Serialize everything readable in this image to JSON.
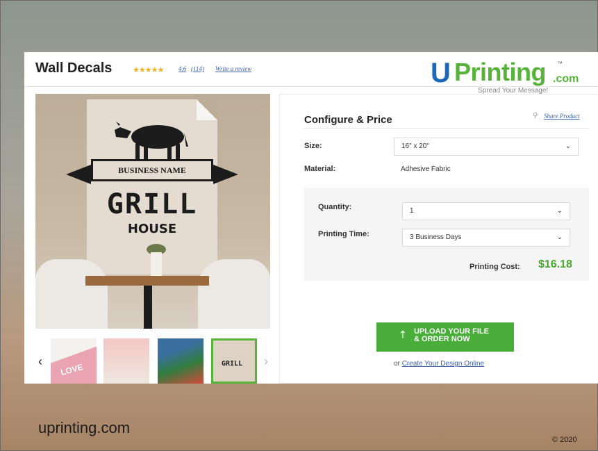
{
  "product": {
    "title": "Wall Decals",
    "stars": "★★★★★",
    "rating": "4.6",
    "reviews": "(114)",
    "write_review": "Write a review"
  },
  "logo": {
    "u": "U",
    "printing": "Printing",
    "com": ".com",
    "tm": "™",
    "tagline": "Spread Your Message!"
  },
  "decal": {
    "banner": "BUSINESS NAME",
    "line1": "GRILL",
    "line2": "HOUSE"
  },
  "thumbs": {
    "prev": "‹",
    "next": "›",
    "t1_text": "LOVE",
    "t4_text": "GRILL"
  },
  "config": {
    "title": "Configure & Price",
    "share": "Share Product",
    "size_label": "Size:",
    "size_value": "16\" x 20\"",
    "material_label": "Material:",
    "material_value": "Adhesive Fabric",
    "quantity_label": "Quantity:",
    "quantity_value": "1",
    "time_label": "Printing Time:",
    "time_value": "3 Business Days",
    "cost_label": "Printing Cost:",
    "cost_value": "$16.18",
    "upload_line1": "UPLOAD YOUR FILE",
    "upload_line2": "& ORDER NOW",
    "design_prefix": "or",
    "design_link": "Create Your Design Online"
  },
  "caption": {
    "site": "uprinting.com",
    "copyright": "© 2020"
  },
  "colors": {
    "accent_green": "#49ad3a",
    "price_green": "#46a631",
    "logo_blue": "#1a68b7",
    "link_blue": "#3a5fa8",
    "star_gold": "#f2b01e"
  }
}
